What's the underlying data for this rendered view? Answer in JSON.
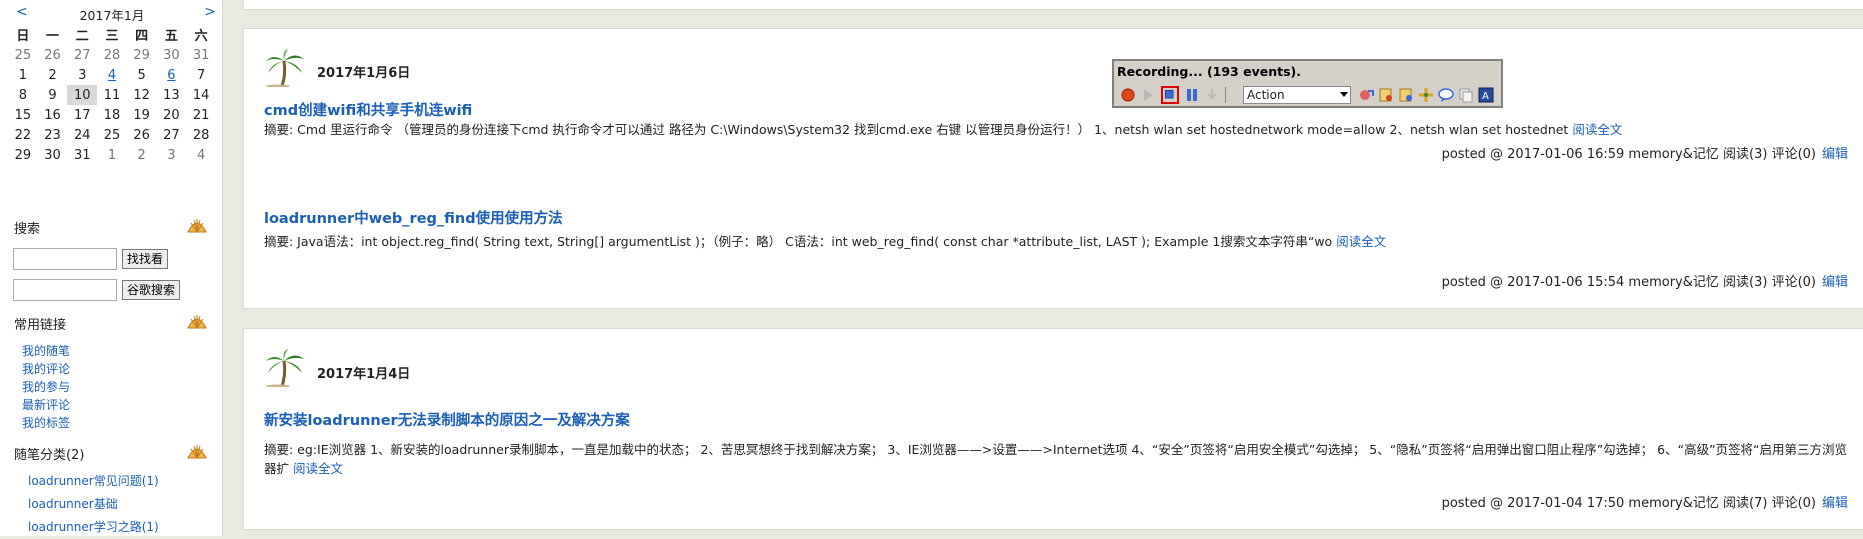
{
  "calendar": {
    "prev": "<",
    "next": ">",
    "title": "2017年1月",
    "weekdays": [
      "日",
      "一",
      "二",
      "三",
      "四",
      "五",
      "六"
    ],
    "weeks": [
      [
        "25",
        "26",
        "27",
        "28",
        "29",
        "30",
        "31"
      ],
      [
        "1",
        "2",
        "3",
        "4",
        "5",
        "6",
        "7"
      ],
      [
        "8",
        "9",
        "10",
        "11",
        "12",
        "13",
        "14"
      ],
      [
        "15",
        "16",
        "17",
        "18",
        "19",
        "20",
        "21"
      ],
      [
        "22",
        "23",
        "24",
        "25",
        "26",
        "27",
        "28"
      ],
      [
        "29",
        "30",
        "31",
        "1",
        "2",
        "3",
        "4"
      ]
    ]
  },
  "sidebar": {
    "search_title": "搜索",
    "search_btn1": "找找看",
    "search_btn2": "谷歌搜索",
    "links_title": "常用链接",
    "links": [
      "我的随笔",
      "我的评论",
      "我的参与",
      "最新评论",
      "我的标签"
    ],
    "cat_title": "随笔分类",
    "cat_count": "(2)",
    "categories": [
      "loadrunner常见问题(1)",
      "loadrunner基础",
      "loadrunner学习之路(1)"
    ]
  },
  "recorder": {
    "title": "Recording... (193 events).",
    "action_value": "Action"
  },
  "days": [
    {
      "date": "2017年1月6日",
      "posts": [
        {
          "title": "cmd创建wifi和共享手机连wifi",
          "summary": "摘要: Cmd 里运行命令 （管理员的身份连接下cmd 执行命令才可以通过 路径为 C:\\Windows\\System32 找到cmd.exe 右键 以管理员身份运行！） 1、netsh wlan set hostednetwork mode=allow 2、netsh wlan set hostednet",
          "read_more": "阅读全文",
          "footer": "posted @ 2017-01-06 16:59 memory&记忆 阅读(3) 评论(0)",
          "edit": "编辑"
        },
        {
          "title": "loadrunner中web_reg_find使用使用方法",
          "summary": "摘要: Java语法：int object.reg_find( String text, String[] argumentList )；（例子：略） C语法：int web_reg_find( const char *attribute_list, LAST ); Example 1搜索文本字符串“wo",
          "read_more": "阅读全文",
          "footer": "posted @ 2017-01-06 15:54 memory&记忆 阅读(3) 评论(0)",
          "edit": "编辑"
        }
      ]
    },
    {
      "date": "2017年1月4日",
      "posts": [
        {
          "title": "新安装loadrunner无法录制脚本的原因之一及解决方案",
          "summary": "摘要: eg:IE浏览器 1、新安装的loadrunner录制脚本，一直是加载中的状态； 2、苦思冥想终于找到解决方案； 3、IE浏览器——>设置——>Internet选项 4、“安全”页签将“启用安全模式”勾选掉； 5、“隐私”页签将“启用弹出窗口阻止程序”勾选掉； 6、“高级”页签将“启用第三方浏览器扩",
          "read_more": "阅读全文",
          "footer": "posted @ 2017-01-04 17:50 memory&记忆 阅读(7) 评论(0)",
          "edit": "编辑"
        }
      ]
    }
  ]
}
